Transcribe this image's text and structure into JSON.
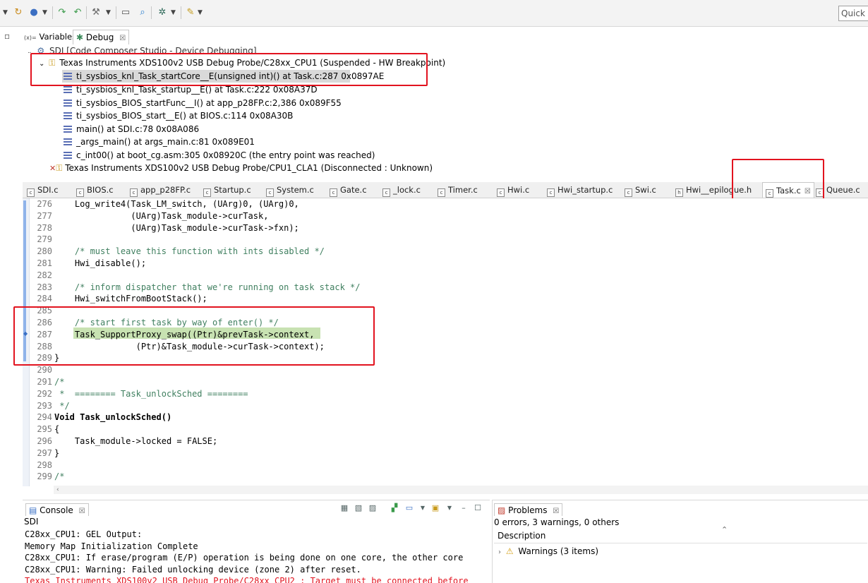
{
  "toolbar": {
    "quick_access_placeholder": "Quick Access",
    "icons": [
      "debug-dropdown-icon",
      "resume-icon",
      "run-icon",
      "step-over-icon",
      "step-return-icon",
      "build-icon",
      "console-icon",
      "search-icon",
      "gear-icon",
      "launch-icon"
    ]
  },
  "debug_view": {
    "tabs": [
      {
        "label": "Variables",
        "prefix": "(x)="
      },
      {
        "label": "Debug"
      }
    ],
    "tree": {
      "root": "SDI [Code Composer Studio - Device Debugging]",
      "cpu1": "Texas Instruments XDS100v2 USB Debug Probe/C28xx_CPU1 (Suspended - HW Breakpoint)",
      "frames": [
        "ti_sysbios_knl_Task_startCore__E(unsigned int)() at Task.c:287 0x0897AE",
        "ti_sysbios_knl_Task_startup__E() at Task.c:222 0x08A37D",
        "ti_sysbios_BIOS_startFunc__I() at app_p28FP.c:2,386 0x089F55",
        "ti_sysbios_BIOS_start__E() at BIOS.c:114 0x08A30B",
        "main() at SDI.c:78 0x08A086",
        "_args_main() at args_main.c:81 0x089E01",
        "c_int00() at boot_cg.asm:305 0x08920C  (the entry point was reached)"
      ],
      "cla1": "Texas Instruments XDS100v2 USB Debug Probe/CPU1_CLA1 (Disconnected : Unknown)"
    }
  },
  "editor": {
    "tabs": [
      "SDI.c",
      "BIOS.c",
      "app_p28FP.c",
      "Startup.c",
      "System.c",
      "Gate.c",
      "_lock.c",
      "Timer.c",
      "Hwi.c",
      "Hwi_startup.c",
      "Swi.c",
      "Hwi__epilogue.h",
      "Task.c",
      "Queue.c"
    ],
    "active_tab": "Task.c",
    "lines": [
      {
        "n": "276",
        "t": "    Log_write4(Task_LM_switch, (UArg)0, (UArg)0,"
      },
      {
        "n": "277",
        "t": "               (UArg)Task_module->curTask,"
      },
      {
        "n": "278",
        "t": "               (UArg)Task_module->curTask->fxn);"
      },
      {
        "n": "279",
        "t": ""
      },
      {
        "n": "280",
        "t": "    /* must leave this function with ints disabled */"
      },
      {
        "n": "281",
        "t": "    Hwi_disable();"
      },
      {
        "n": "282",
        "t": ""
      },
      {
        "n": "283",
        "t": "    /* inform dispatcher that we're running on task stack */"
      },
      {
        "n": "284",
        "t": "    Hwi_switchFromBootStack();"
      },
      {
        "n": "285",
        "t": ""
      },
      {
        "n": "286",
        "t": "    /* start first task by way of enter() */"
      },
      {
        "n": "287",
        "t": "    Task_SupportProxy_swap((Ptr)&prevTask->context,"
      },
      {
        "n": "288",
        "t": "                (Ptr)&Task_module->curTask->context);"
      },
      {
        "n": "289",
        "t": "}"
      },
      {
        "n": "290",
        "t": ""
      },
      {
        "n": "291",
        "t": "/*"
      },
      {
        "n": "292",
        "t": " *  ======== Task_unlockSched ========"
      },
      {
        "n": "293",
        "t": " */"
      },
      {
        "n": "294",
        "t": "Void Task_unlockSched()"
      },
      {
        "n": "295",
        "t": "{"
      },
      {
        "n": "296",
        "t": "    Task_module->locked = FALSE;"
      },
      {
        "n": "297",
        "t": "}"
      },
      {
        "n": "298",
        "t": ""
      },
      {
        "n": "299",
        "t": "/*"
      }
    ]
  },
  "console": {
    "tab_label": "Console",
    "session": "SDI",
    "lines": [
      "C28xx_CPU1: GEL Output:",
      "Memory Map Initialization Complete",
      "C28xx_CPU1: If erase/program (E/P) operation is being done on one core, the other core",
      "C28xx_CPU1: Warning: Failed unlocking device (zone 2) after reset.",
      "Texas Instruments XDS100v2 USB Debug Probe/C28xx_CPU2 : Target must be connected before"
    ]
  },
  "problems": {
    "tab_label": "Problems",
    "summary": "0 errors, 3 warnings, 0 others",
    "column": "Description",
    "warnings": "Warnings (3 items)"
  },
  "colors": {
    "highlight_box": "#e2131f",
    "current_line": "#c8e2b2",
    "comment": "#3f7f5f",
    "error_text": "#e2131f"
  }
}
